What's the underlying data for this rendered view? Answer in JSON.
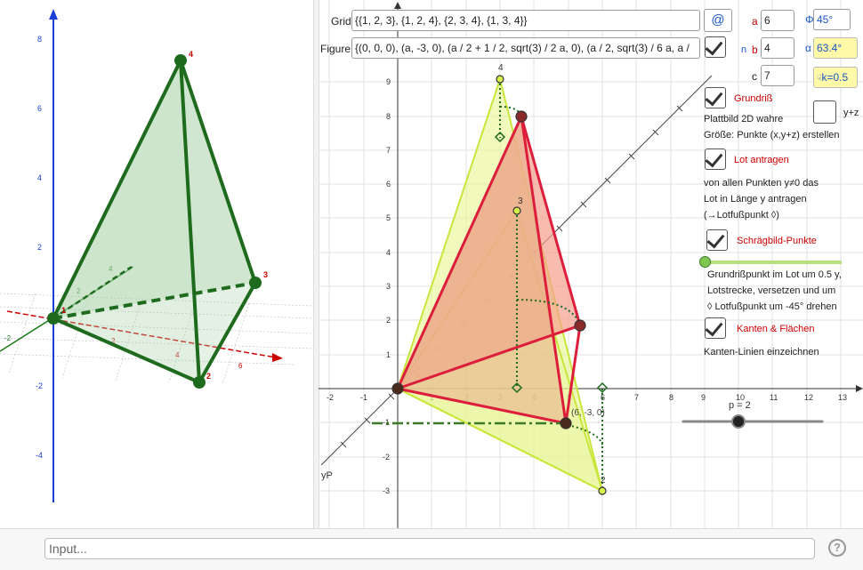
{
  "grid_label": "Grid",
  "grid_value": "{{1, 2, 3}, {1, 2, 4}, {2, 3, 4}, {1, 3, 4}}",
  "figure_label": "Figure",
  "figure_value": "{(0, 0, 0), (a, -3, 0), (a / 2 + 1 / 2, sqrt(3) / 2 a, 0), (a / 2, sqrt(3) / 6 a, a /",
  "at_button": "@",
  "params": {
    "a_label": "a",
    "a_value": "6",
    "b_label": "b",
    "b_value": "4",
    "c_label": "c",
    "c_value": "7",
    "phi_label": "Φ",
    "phi_value": "45°",
    "alpha_label": "α",
    "alpha_value": "63.4°",
    "k_value": "k=0.5",
    "n_label": "n",
    "yz_label": "y+z"
  },
  "checkboxes": {
    "grundriss": "Grundriß",
    "lot": "Lot antragen",
    "schraegbild": "Schrägbild-Punkte",
    "kanten": "Kanten & Flächen"
  },
  "texts": {
    "grundriss_desc1": "Plattbild 2D wahre",
    "grundriss_desc2": "Größe: Punkte (x,y+z) erstellen",
    "lot_desc1": "von allen Punkten y≠0 das",
    "lot_desc2": "Lot in Länge y antragen",
    "lot_desc3": "(→Lotfußpunkt ◊)",
    "schraeg_desc1": "Grundrißpunkt im Lot um 0.5 y,",
    "schraeg_desc2": "Lotstrecke, versetzen und um",
    "schraeg_desc3": "◊ Lotfußpunkt um -45° drehen",
    "kanten_desc": "Kanten-Linien einzeichnen"
  },
  "slider_p_label": "p = 2",
  "point_label_yp": "yP",
  "point_label_6m30": "(6, -3, 0)",
  "pt_labels": {
    "v1": "1",
    "v2": "2",
    "v3": "3",
    "v4": "4"
  },
  "axis3d": {
    "z_ticks": [
      "8",
      "6",
      "4",
      "2",
      "-2",
      "-4"
    ],
    "x_ticks": [
      "2",
      "4",
      "6"
    ],
    "y_ticks": [
      "-2",
      "2",
      "4"
    ]
  },
  "axis2d": {
    "x_ticks": [
      "-2",
      "-1",
      "1",
      "2",
      "3",
      "4",
      "5",
      "6",
      "7",
      "8",
      "9",
      "10",
      "11",
      "12",
      "13"
    ],
    "y_ticks": [
      "9",
      "8",
      "7",
      "6",
      "5",
      "4",
      "3",
      "2",
      "1",
      "-1",
      "-2",
      "-3"
    ]
  },
  "input_placeholder": "Input...",
  "help_icon": "?"
}
